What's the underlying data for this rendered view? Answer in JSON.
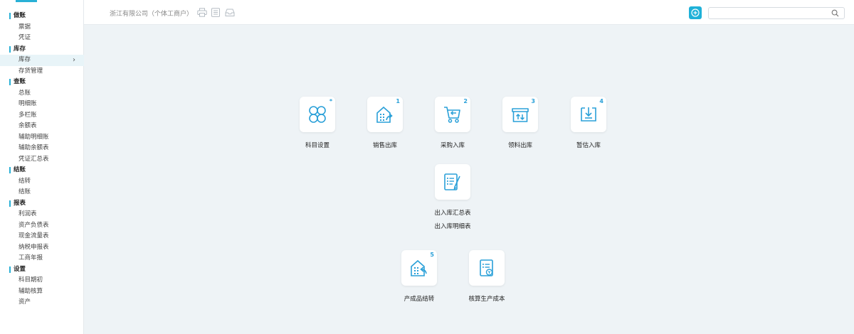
{
  "company": "浙江有限公司（个体工商户）",
  "search": {
    "placeholder": ""
  },
  "colors": {
    "accent": "#29b0d6",
    "icon": "#2aa0d8"
  },
  "sidebar": {
    "sections": [
      {
        "title": "做账",
        "items": [
          "票据",
          "凭证"
        ]
      },
      {
        "title": "库存",
        "items": [
          "库存",
          "存货管理"
        ]
      },
      {
        "title": "查账",
        "items": [
          "总账",
          "明细账",
          "多栏账",
          "余额表",
          "辅助明细账",
          "辅助余额表",
          "凭证汇总表"
        ]
      },
      {
        "title": "结账",
        "items": [
          "结转",
          "结账"
        ]
      },
      {
        "title": "报表",
        "items": [
          "利润表",
          "资产负债表",
          "现金流量表",
          "纳税申报表",
          "工商年报"
        ]
      },
      {
        "title": "设置",
        "items": [
          "科目期初",
          "辅助核算",
          "资产"
        ]
      }
    ],
    "active_item": "库存"
  },
  "tiles": {
    "kemu": {
      "label": "科目设置",
      "badge": "*",
      "icon": "four-petal-icon"
    },
    "xiaoshou": {
      "label": "销售出库",
      "badge": "1",
      "icon": "building-out-icon"
    },
    "caigou": {
      "label": "采购入库",
      "badge": "2",
      "icon": "cart-icon"
    },
    "lingliao": {
      "label": "领料出库",
      "badge": "3",
      "icon": "box-up-icon"
    },
    "zangu": {
      "label": "暂估入库",
      "badge": "4",
      "icon": "inbox-down-icon"
    },
    "huizong": {
      "label": "出入库汇总表",
      "label2": "出入库明细表",
      "icon": "list-pen-icon"
    },
    "chanchengpin": {
      "label": "产成品结转",
      "badge": "5",
      "icon": "building-return-icon"
    },
    "hesuan": {
      "label": "核算生产成本",
      "icon": "doc-coin-icon"
    }
  }
}
